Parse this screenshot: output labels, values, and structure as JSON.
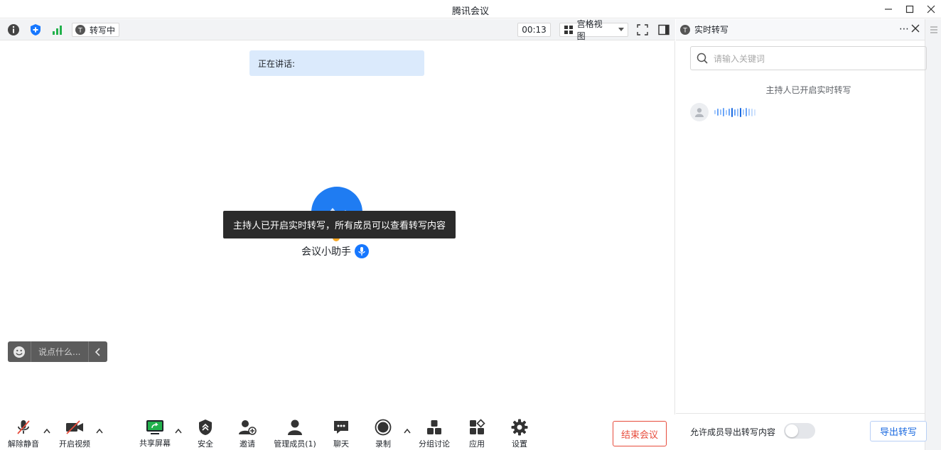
{
  "window": {
    "title": "腾讯会议",
    "controls": [
      "minimize-icon",
      "maximize-icon",
      "close-icon"
    ]
  },
  "toolbar": {
    "icons": [
      "info-icon",
      "shield-icon",
      "signal-icon"
    ],
    "transcribing_label": "转写中",
    "timer": "00:13",
    "view_mode_label": "宫格视图",
    "right_icons": [
      "fullscreen-icon",
      "sidebar-toggle-icon"
    ]
  },
  "main": {
    "speaking_label": "正在讲话:",
    "toast": "主持人已开启实时转写，所有成员可以查看转写内容",
    "assistant_name": "会议小助手",
    "chat_placeholder": "说点什么..."
  },
  "bottom": {
    "buttons": [
      {
        "label": "解除静音",
        "icon": "mic-muted-icon"
      },
      {
        "label": "开启视频",
        "icon": "video-off-icon"
      },
      {
        "label": "共享屏幕",
        "icon": "share-screen-icon"
      },
      {
        "label": "安全",
        "icon": "security-icon"
      },
      {
        "label": "邀请",
        "icon": "invite-icon"
      },
      {
        "label": "管理成员(1)",
        "icon": "members-icon"
      },
      {
        "label": "聊天",
        "icon": "chat-icon"
      },
      {
        "label": "录制",
        "icon": "record-icon"
      },
      {
        "label": "分组讨论",
        "icon": "breakout-icon"
      },
      {
        "label": "应用",
        "icon": "apps-icon"
      },
      {
        "label": "设置",
        "icon": "settings-icon"
      }
    ],
    "end_label": "结束会议"
  },
  "panel": {
    "title": "实时转写",
    "search_placeholder": "请输入关键词",
    "notice": "主持人已开启实时转写",
    "allow_export_label": "允许成员导出转写内容",
    "allow_export_enabled": false,
    "export_label": "导出转写"
  },
  "colors": {
    "accent": "#1677ff",
    "danger": "#e74c3c",
    "speaking_bg": "#dbeafc"
  }
}
